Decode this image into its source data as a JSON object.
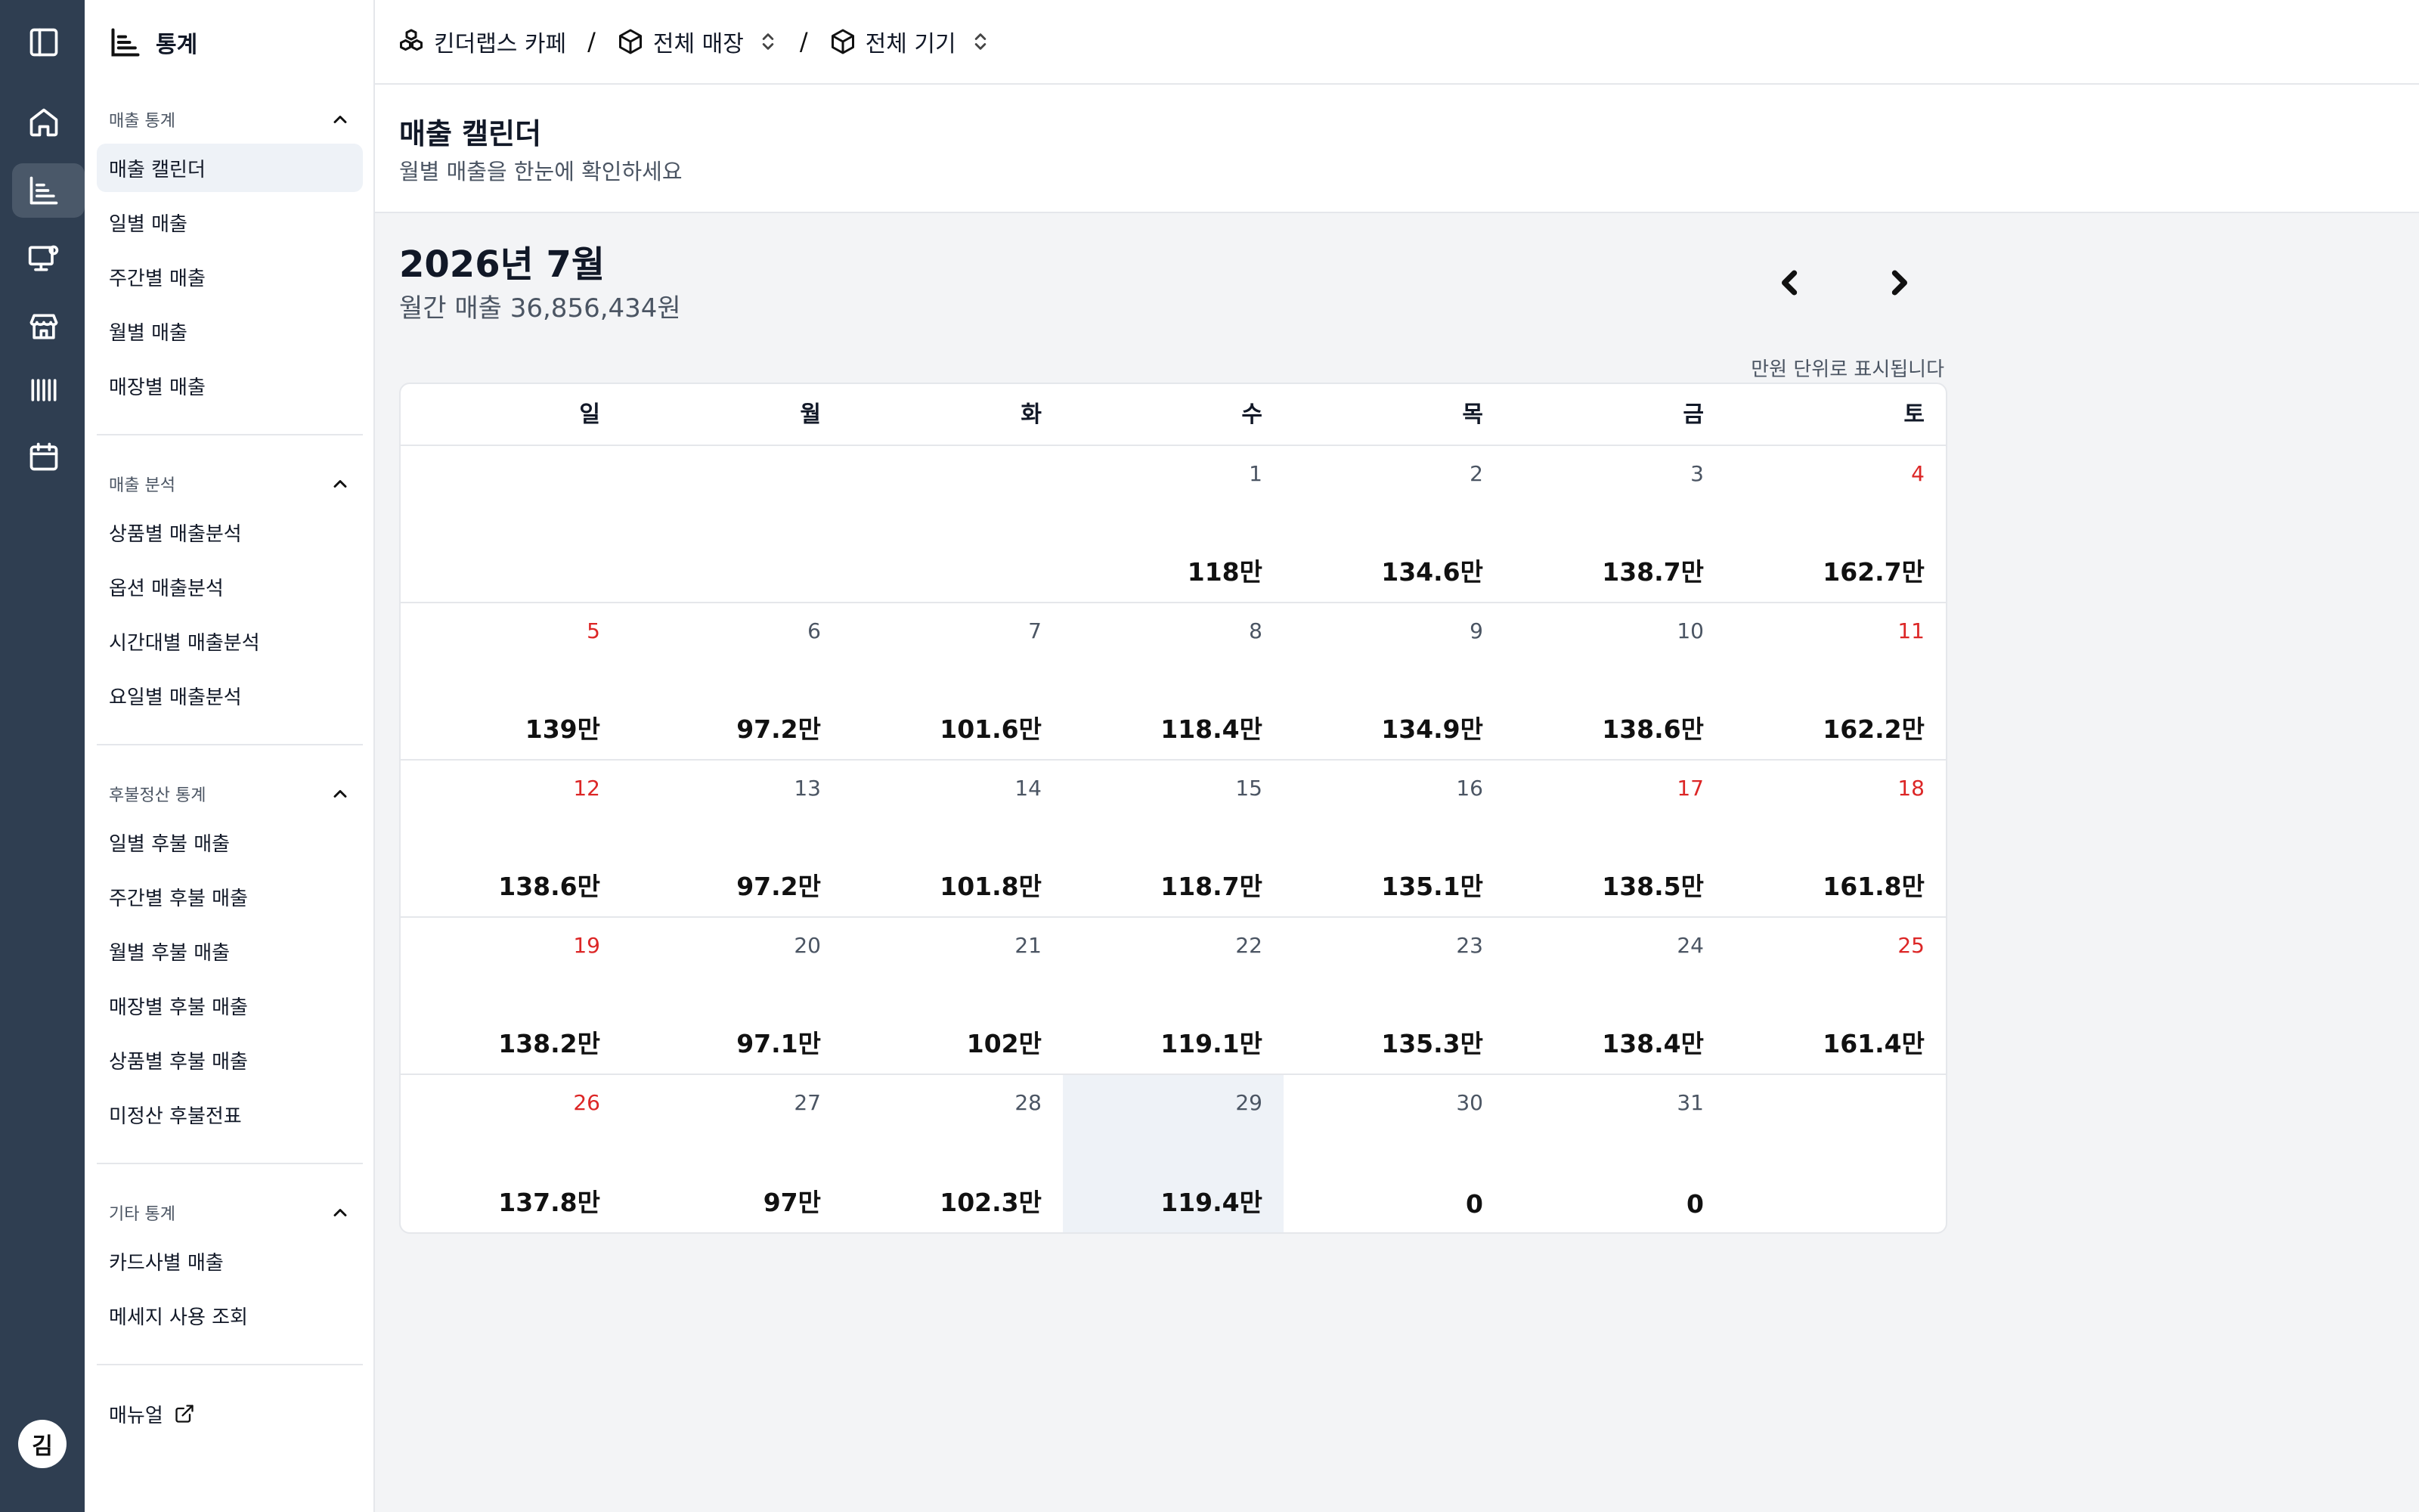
{
  "sidebar": {
    "title": "통계",
    "groups": [
      {
        "title": "매출 통계",
        "items": [
          "매출 캘린더",
          "일별 매출",
          "주간별 매출",
          "월별 매출",
          "매장별 매출"
        ]
      },
      {
        "title": "매출 분석",
        "items": [
          "상품별 매출분석",
          "옵션 매출분석",
          "시간대별 매출분석",
          "요일별 매출분석"
        ]
      },
      {
        "title": "후불정산 통계",
        "items": [
          "일별 후불 매출",
          "주간별 후불 매출",
          "월별 후불 매출",
          "매장별 후불 매출",
          "상품별 후불 매출",
          "미정산 후불전표"
        ]
      },
      {
        "title": "기타 통계",
        "items": [
          "카드사별 매출",
          "메세지 사용 조회"
        ]
      }
    ],
    "manual": "매뉴얼"
  },
  "rail": {
    "avatar": "김"
  },
  "breadcrumb": {
    "org": "킨더랩스 카페",
    "store": "전체 매장",
    "device": "전체 기기",
    "sep": "/"
  },
  "page": {
    "title": "매출 캘린더",
    "subtitle": "월별 매출을 한눈에 확인하세요"
  },
  "calendar": {
    "month_label": "2026년 7월",
    "monthly_total": "월간 매출 36,856,434원",
    "unit_note": "만원 단위로 표시됩니다",
    "weekdays": [
      "일",
      "월",
      "화",
      "수",
      "목",
      "금",
      "토"
    ],
    "weeks": [
      [
        {
          "day": "",
          "amt": ""
        },
        {
          "day": "",
          "amt": ""
        },
        {
          "day": "",
          "amt": ""
        },
        {
          "day": "1",
          "amt": "118만"
        },
        {
          "day": "2",
          "amt": "134.6만"
        },
        {
          "day": "3",
          "amt": "138.7만"
        },
        {
          "day": "4",
          "amt": "162.7만",
          "red": true
        }
      ],
      [
        {
          "day": "5",
          "amt": "139만",
          "red": true
        },
        {
          "day": "6",
          "amt": "97.2만"
        },
        {
          "day": "7",
          "amt": "101.6만"
        },
        {
          "day": "8",
          "amt": "118.4만"
        },
        {
          "day": "9",
          "amt": "134.9만"
        },
        {
          "day": "10",
          "amt": "138.6만"
        },
        {
          "day": "11",
          "amt": "162.2만",
          "red": true
        }
      ],
      [
        {
          "day": "12",
          "amt": "138.6만",
          "red": true
        },
        {
          "day": "13",
          "amt": "97.2만"
        },
        {
          "day": "14",
          "amt": "101.8만"
        },
        {
          "day": "15",
          "amt": "118.7만"
        },
        {
          "day": "16",
          "amt": "135.1만"
        },
        {
          "day": "17",
          "amt": "138.5만",
          "red": true
        },
        {
          "day": "18",
          "amt": "161.8만",
          "red": true
        }
      ],
      [
        {
          "day": "19",
          "amt": "138.2만",
          "red": true
        },
        {
          "day": "20",
          "amt": "97.1만"
        },
        {
          "day": "21",
          "amt": "102만"
        },
        {
          "day": "22",
          "amt": "119.1만"
        },
        {
          "day": "23",
          "amt": "135.3만"
        },
        {
          "day": "24",
          "amt": "138.4만"
        },
        {
          "day": "25",
          "amt": "161.4만",
          "red": true
        }
      ],
      [
        {
          "day": "26",
          "amt": "137.8만",
          "red": true
        },
        {
          "day": "27",
          "amt": "97만"
        },
        {
          "day": "28",
          "amt": "102.3만"
        },
        {
          "day": "29",
          "amt": "119.4만",
          "today": true
        },
        {
          "day": "30",
          "amt": "0"
        },
        {
          "day": "31",
          "amt": "0"
        },
        {
          "day": "",
          "amt": ""
        }
      ]
    ]
  }
}
